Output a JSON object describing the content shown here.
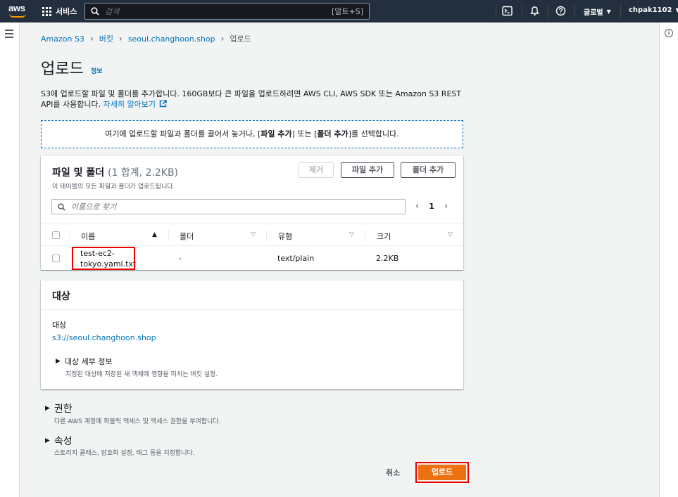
{
  "topnav": {
    "logo_text": "aws",
    "services_label": "서비스",
    "search_placeholder": "검색",
    "search_shortcut": "[알트+S]",
    "region_label": "글로벌",
    "account_label": "chpak1102",
    "icons": [
      "cloudshell-icon",
      "bell-icon",
      "help-icon"
    ]
  },
  "breadcrumb": {
    "items": [
      "Amazon S3",
      "버킷",
      "seoul.changhoon.shop"
    ],
    "current": "업로드"
  },
  "page": {
    "title": "업로드",
    "info_link": "정보",
    "description": "S3에 업로드할 파일 및 폴더를 추가합니다. 160GB보다 큰 파일을 업로드하려면 AWS CLI, AWS SDK 또는 Amazon S3 REST API를 사용합니다.",
    "learn_more": "자세히 알아보기"
  },
  "dropzone": {
    "text_before": "여기에 업로드할 파일과 폴더를 끌어서 놓거나, [",
    "add_files": "파일 추가",
    "text_mid": "] 또는 [",
    "add_folder": "폴더 추가",
    "text_after": "]를 선택합니다."
  },
  "files": {
    "title": "파일 및 폴더",
    "count": "(1 합계, 2.2KB)",
    "subtitle": "이 테이블의 모든 파일과 폴더가 업로드됩니다.",
    "remove_label": "제거",
    "add_files_label": "파일 추가",
    "add_folder_label": "폴더 추가",
    "search_placeholder": "이름으로 찾기",
    "page_number": "1",
    "columns": [
      "이름",
      "폴더",
      "유형",
      "크기"
    ],
    "rows": [
      {
        "name_line1": "test-ec2-",
        "name_line2": "tokyo.yaml.txt",
        "folder": "-",
        "type": "text/plain",
        "size": "2.2KB"
      }
    ]
  },
  "destination": {
    "title": "대상",
    "label": "대상",
    "uri": "s3://seoul.changhoon.shop",
    "details_title": "대상 세부 정보",
    "details_desc": "지정된 대상에 저장된 새 객체에 영향을 미치는 버킷 설정."
  },
  "permissions": {
    "title": "권한",
    "desc": "다른 AWS 계정에 퍼블릭 액세스 및 액세스 권한을 부여합니다."
  },
  "properties": {
    "title": "속성",
    "desc": "스토리지 클래스, 암호화 설정, 태그 등을 지정합니다."
  },
  "actions": {
    "cancel_label": "취소",
    "upload_label": "업로드"
  },
  "colors": {
    "nav_bg": "#232f3e",
    "link": "#0073bb",
    "primary": "#ec7211",
    "highlight": "#ee0000"
  }
}
